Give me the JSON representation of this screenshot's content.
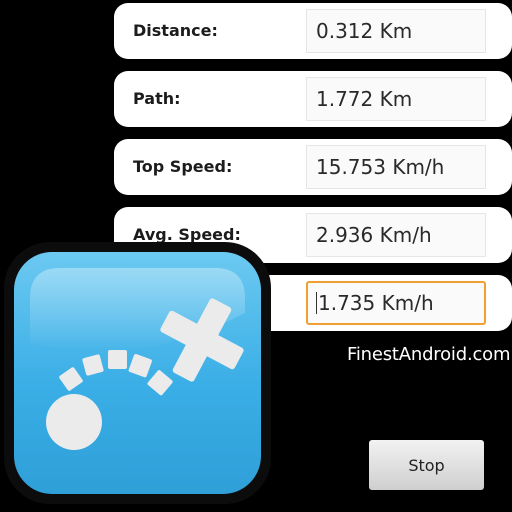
{
  "stats": [
    {
      "label": "Distance:",
      "value": "0.312 Km"
    },
    {
      "label": "Path:",
      "value": "1.772 Km"
    },
    {
      "label": "Top Speed:",
      "value": "15.753 Km/h"
    },
    {
      "label": "Avg. Speed:",
      "value": "2.936 Km/h"
    },
    {
      "label": "",
      "value": "1.735 Km/h"
    }
  ],
  "watermark": "FinestAndroid.com",
  "stop_label": "Stop",
  "app_icon": {
    "name": "route-tracker-icon",
    "color": "#45b3e6"
  }
}
